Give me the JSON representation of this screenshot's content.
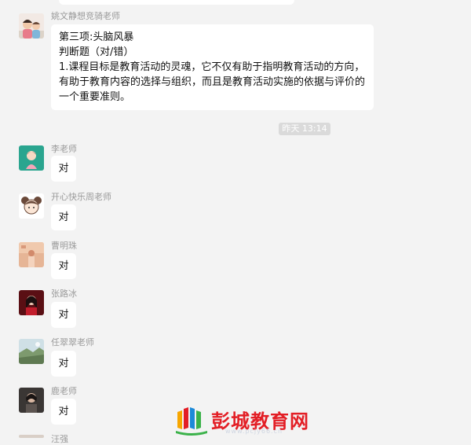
{
  "chat": {
    "first": {
      "sender": "姚文静想竞骑老师",
      "lines": [
        "第三项:头脑风暴",
        "判断题（对/错）",
        "1.课程目标是教育活动的灵魂，它不仅有助于指明教育活动的方向，",
        "有助于教育内容的选择与组织，而且是教育活动实施的依据与评价的",
        "一个重要准则。"
      ]
    },
    "timestamp": "昨天 13:14",
    "replies": [
      {
        "sender": "李老师",
        "text": "对"
      },
      {
        "sender": "开心快乐周老师",
        "text": "对"
      },
      {
        "sender": "曹明珠",
        "text": "对"
      },
      {
        "sender": "张路冰",
        "text": "对"
      },
      {
        "sender": "任翠翠老师",
        "text": "对"
      },
      {
        "sender": "鹿老师",
        "text": "对"
      }
    ],
    "partial_sender": "汪强"
  },
  "watermark": {
    "name": "彭城教育网",
    "url": "www.pcjy66.cn"
  },
  "colors": {
    "background": "#f3f3f3",
    "bubble": "#ffffff",
    "sender_text": "#9a9a9a",
    "watermark_red": "#e31e25"
  }
}
